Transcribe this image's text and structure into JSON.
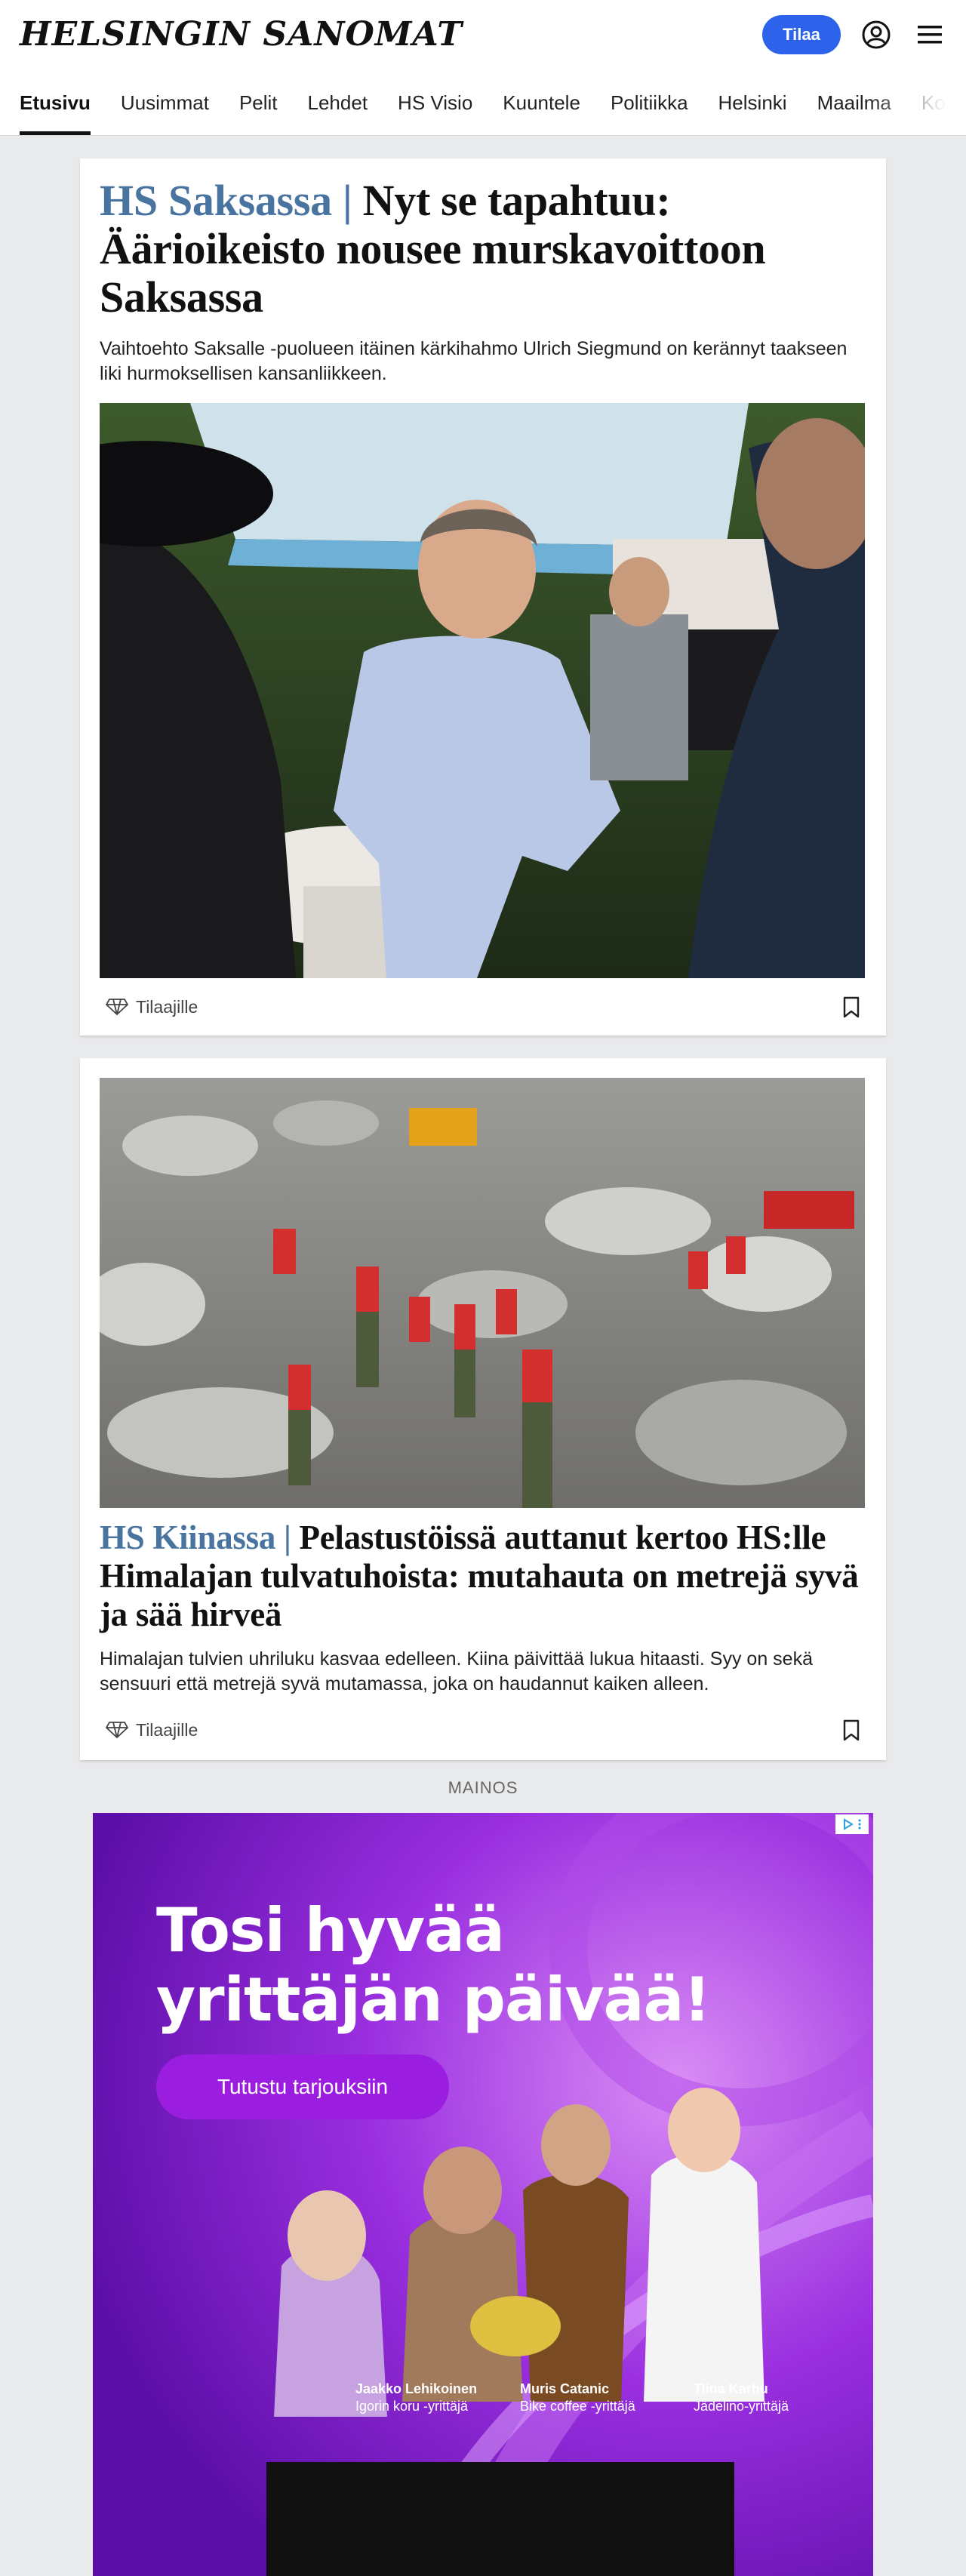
{
  "header": {
    "logo": "HELSINGIN SANOMAT",
    "subscribe_label": "Tilaa"
  },
  "nav": {
    "items": [
      {
        "label": "Etusivu",
        "active": true
      },
      {
        "label": "Uusimmat"
      },
      {
        "label": "Pelit"
      },
      {
        "label": "Lehdet"
      },
      {
        "label": "HS Visio"
      },
      {
        "label": "Kuuntele"
      },
      {
        "label": "Politiikka"
      },
      {
        "label": "Helsinki"
      },
      {
        "label": "Maailma"
      },
      {
        "label": "Ko"
      }
    ]
  },
  "articles": [
    {
      "kicker": "HS Saksassa |",
      "title": " Nyt se tapahtuu: Äärioikeisto nousee murskavoittoon Saksassa",
      "lead": "Vaihtoehto Saksalle -puolueen itäinen kärkihahmo Ulrich Siegmund on kerännyt taakseen liki hurmoksellisen kansanliikkeen.",
      "access_label": "Tilaajille"
    },
    {
      "kicker": "HS Kiinassa |",
      "title": " Pelastustöissä auttanut kertoo HS:lle Himalajan tulvatuhoista: mutahauta on metrejä syvä ja sää hirveä",
      "lead": "Himalajan tulvien uhriluku kasvaa edelleen. Kiina päivittää lukua hitaasti. Syy on sekä sensuuri että metrejä syvä mutamassa, joka on haudannut kaiken alleen.",
      "access_label": "Tilaajille"
    }
  ],
  "ad": {
    "label": "MAINOS",
    "headline": "Tosi hyvää yrittäjän päivää!",
    "cta": "Tutustu tarjouksiin",
    "people": [
      {
        "name": "Jaakko Lehikoinen",
        "role": "Igorin koru -yrittäjä"
      },
      {
        "name": "Muris Catanic",
        "role": "Bike coffee -yrittäjä"
      },
      {
        "name": "Tiina Karhu",
        "role": "Jädelino-yrittäjä"
      }
    ]
  },
  "colors": {
    "accent_blue": "#2d63ea",
    "kicker_blue": "#4a74a0",
    "ad_purple": "#8a1fd0"
  },
  "icons": [
    "account-icon",
    "menu-icon",
    "diamond-icon",
    "bookmark-icon"
  ]
}
